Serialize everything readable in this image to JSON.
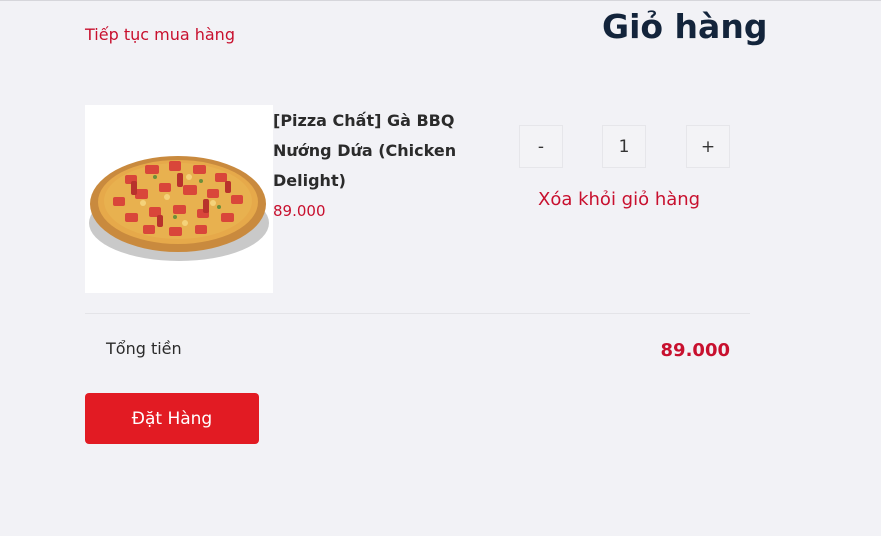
{
  "header": {
    "continue_shopping": "Tiếp tục mua hàng",
    "title": "Giỏ hàng"
  },
  "cart": {
    "items": [
      {
        "name": "[Pizza Chất] Gà BBQ Nướng Dứa (Chicken Delight)",
        "price": "89.000",
        "quantity": "1",
        "decrement_label": "-",
        "increment_label": "+",
        "remove_label": "Xóa khỏi giỏ hàng",
        "image_icon": "pizza-image"
      }
    ]
  },
  "summary": {
    "total_label": "Tổng tiền",
    "total_value": "89.000"
  },
  "actions": {
    "order_label": "Đặt Hàng"
  },
  "colors": {
    "accent": "#c8102e",
    "button": "#e21b23",
    "title": "#13243b",
    "background": "#f2f2f6"
  }
}
